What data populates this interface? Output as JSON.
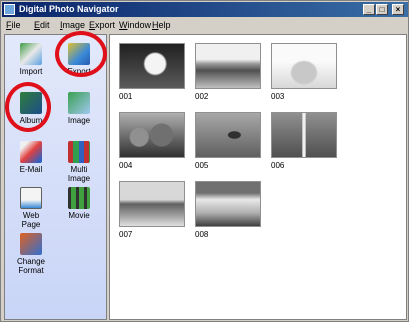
{
  "window": {
    "title": "Digital Photo Navigator"
  },
  "menubar": [
    "File",
    "Edit",
    "Image",
    "Export",
    "Window",
    "Help"
  ],
  "window_controls": {
    "minimize": "_",
    "maximize": "□",
    "close": "×"
  },
  "sidebar": {
    "tools": [
      {
        "label": "Import",
        "icon": "import-icon"
      },
      {
        "label": "Export",
        "icon": "export-icon"
      },
      {
        "label": "Album",
        "icon": "album-icon"
      },
      {
        "label": "Image",
        "icon": "image-icon"
      },
      {
        "label": "E-Mail",
        "icon": "email-icon"
      },
      {
        "label": "Multi\nImage",
        "icon": "multi-image-icon"
      },
      {
        "label": "Web\nPage",
        "icon": "web-page-icon"
      },
      {
        "label": "Movie",
        "icon": "movie-icon"
      },
      {
        "label": "Change\nFormat",
        "icon": "change-format-icon"
      }
    ],
    "highlighted": [
      "Export",
      "Album"
    ],
    "highlight_color": "#e0101a"
  },
  "thumbnails": [
    "001",
    "002",
    "003",
    "004",
    "005",
    "006",
    "007",
    "008"
  ]
}
